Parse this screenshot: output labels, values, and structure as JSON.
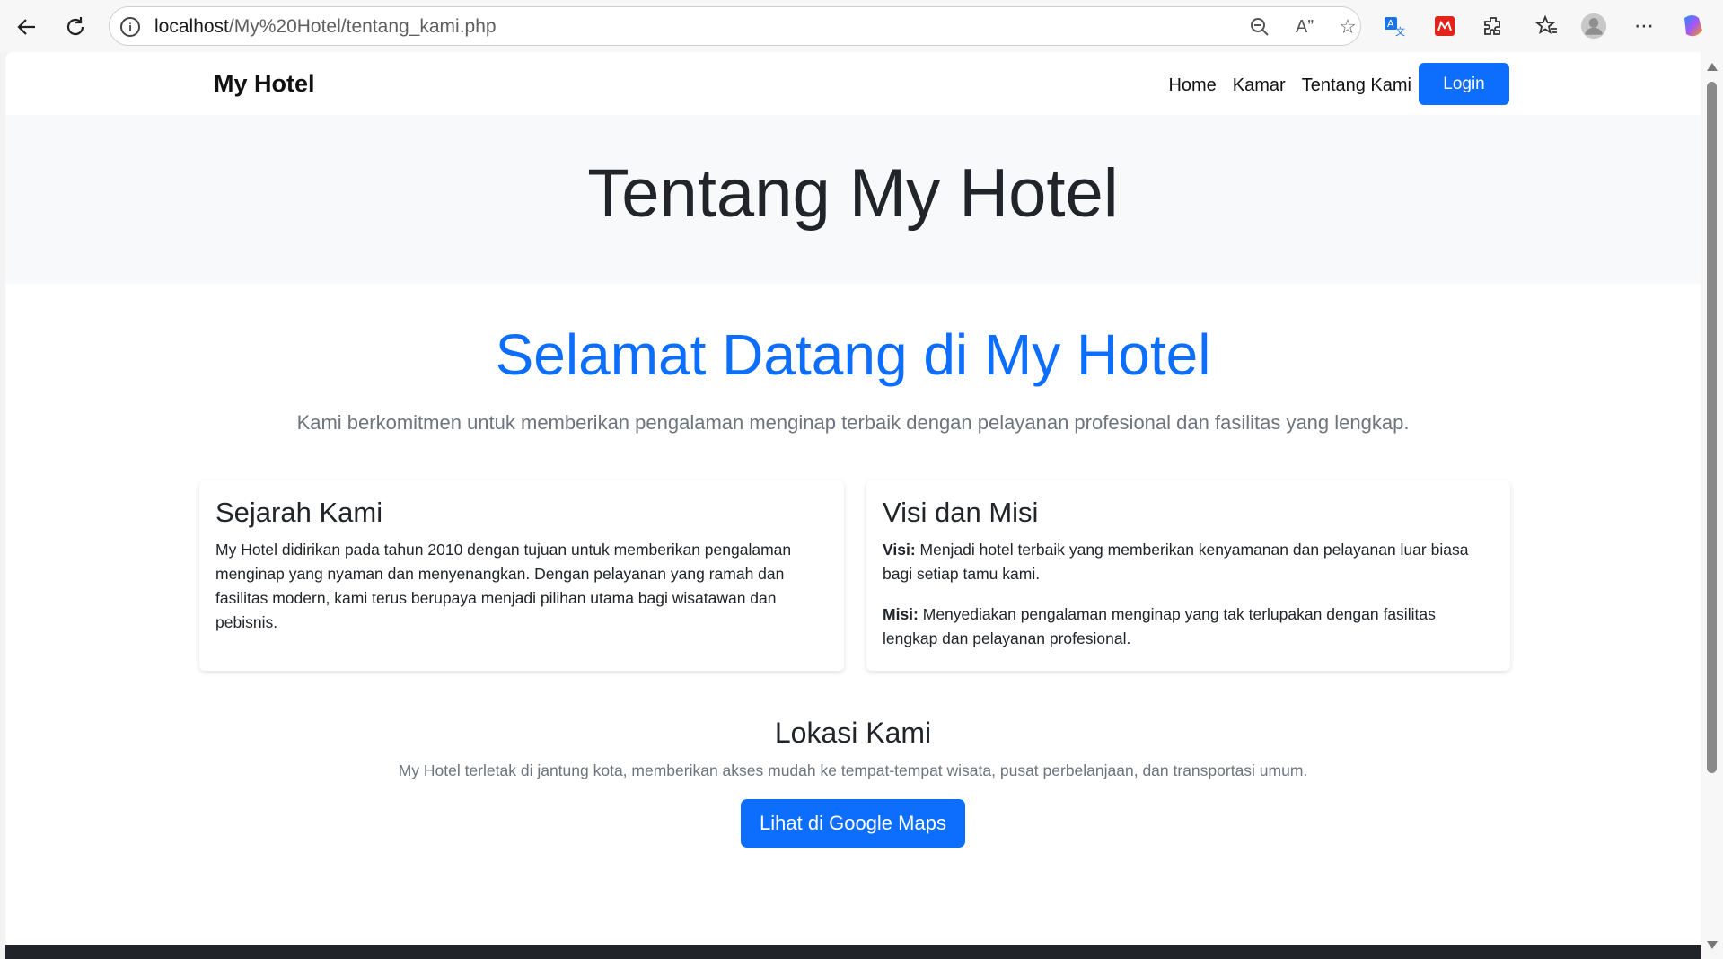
{
  "browser": {
    "url_host": "localhost",
    "url_path": "/My%20Hotel/tentang_kami.php"
  },
  "nav": {
    "brand": "My Hotel",
    "links": [
      "Home",
      "Kamar",
      "Tentang Kami"
    ],
    "login": "Login"
  },
  "hero": {
    "title": "Tentang My Hotel"
  },
  "welcome": {
    "title": "Selamat Datang di My Hotel",
    "subtitle": "Kami berkomitmen untuk memberikan pengalaman menginap terbaik dengan pelayanan profesional dan fasilitas yang lengkap."
  },
  "history": {
    "title": "Sejarah Kami",
    "text": "My Hotel didirikan pada tahun 2010 dengan tujuan untuk memberikan pengalaman menginap yang nyaman dan menyenangkan. Dengan pelayanan yang ramah dan fasilitas modern, kami terus berupaya menjadi pilihan utama bagi wisatawan dan pebisnis."
  },
  "vision": {
    "title": "Visi dan Misi",
    "visi_label": "Visi:",
    "visi_text": " Menjadi hotel terbaik yang memberikan kenyamanan dan pelayanan luar biasa bagi setiap tamu kami.",
    "misi_label": "Misi:",
    "misi_text": " Menyediakan pengalaman menginap yang tak terlupakan dengan fasilitas lengkap dan pelayanan profesional."
  },
  "location": {
    "title": "Lokasi Kami",
    "text": "My Hotel terletak di jantung kota, memberikan akses mudah ke tempat-tempat wisata, pusat perbelanjaan, dan transportasi umum.",
    "button": "Lihat di Google Maps"
  },
  "colors": {
    "primary": "#0d6efd",
    "hero_bg": "#f8f9fa",
    "footer": "#212529"
  },
  "icons": [
    "back-icon",
    "refresh-icon",
    "info-icon",
    "zoom-icon",
    "read-aloud-icon",
    "favorite-star-icon",
    "translate-icon",
    "extension-red-icon",
    "extensions-icon",
    "favorites-icon",
    "profile-icon",
    "more-icon",
    "copilot-icon"
  ]
}
